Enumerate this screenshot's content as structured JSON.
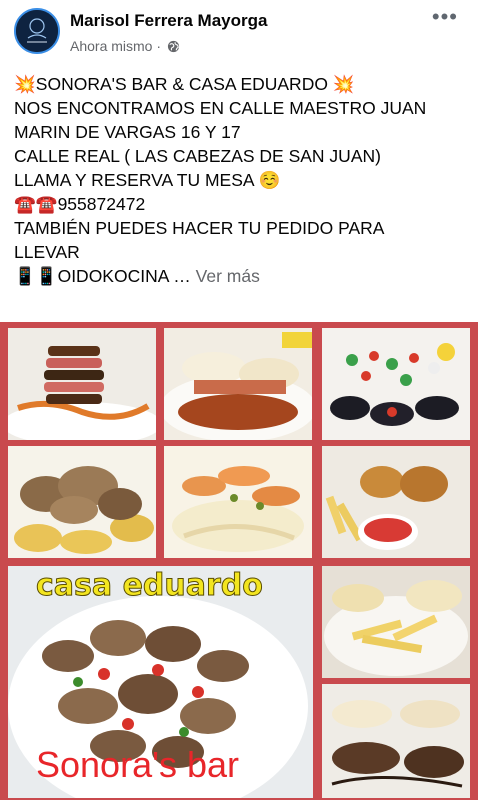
{
  "post": {
    "author": "Marisol Ferrera Mayorga",
    "time": "Ahora mismo",
    "dot": "·",
    "more": "•••",
    "lines": [
      "💥SONORA'S BAR & CASA EDUARDO 💥",
      "NOS ENCONTRAMOS EN CALLE MAESTRO JUAN",
      "MARIN DE VARGAS 16 Y 17",
      "CALLE REAL ( LAS CABEZAS DE SAN JUAN)",
      "LLAMA Y RESERVA TU MESA ☺️",
      "☎️☎️955872472",
      "TAMBIÉN PUEDES HACER TU PEDIDO PARA",
      "LLEVAR"
    ],
    "last_line": "📱📱OIDOKOCINA …",
    "see_more": "Ver más"
  },
  "collage": {
    "title": "casa eduardo",
    "footer": "Sonora's bar",
    "border_color": "#c94a4e"
  }
}
